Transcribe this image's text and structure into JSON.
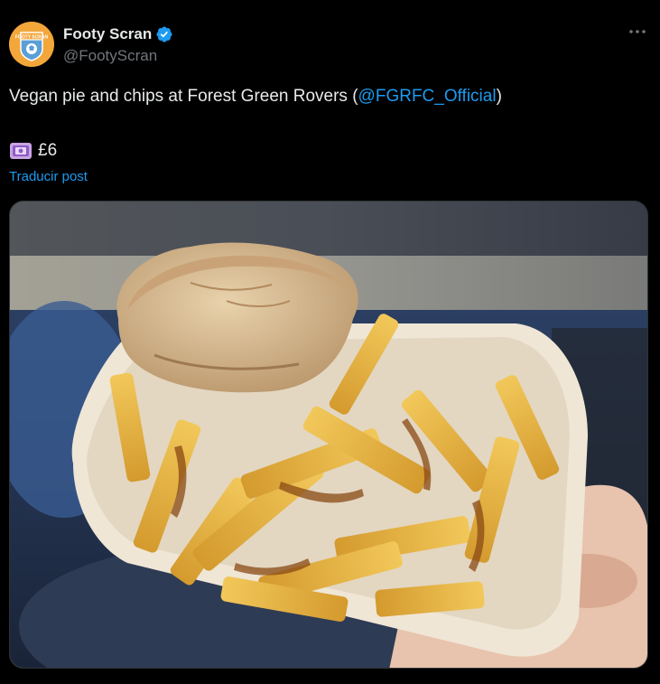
{
  "post": {
    "author": {
      "display_name": "Footy Scran",
      "handle": "@FootyScran",
      "verified": true,
      "avatar_icon": "footy-scran-badge-logo",
      "avatar_text": "FOOTY SCRAN"
    },
    "more_icon": "ellipsis-icon",
    "text_before_mention": "Vegan pie and chips at Forest Green Rovers (",
    "mention": "@FGRFC_Official",
    "text_after_mention": ")",
    "price_emoji": "money-with-wings-icon",
    "price": "£6",
    "translate_label": "Traducir post",
    "media": {
      "alt": "Vegan pie on top of chips with gravy in a paper tray held in a hand"
    }
  },
  "colors": {
    "background": "#000000",
    "text": "#e7e9ea",
    "secondary": "#71767b",
    "link": "#1d9bf0",
    "verified": "#1d9bf0",
    "avatar": "#f3a63a"
  }
}
